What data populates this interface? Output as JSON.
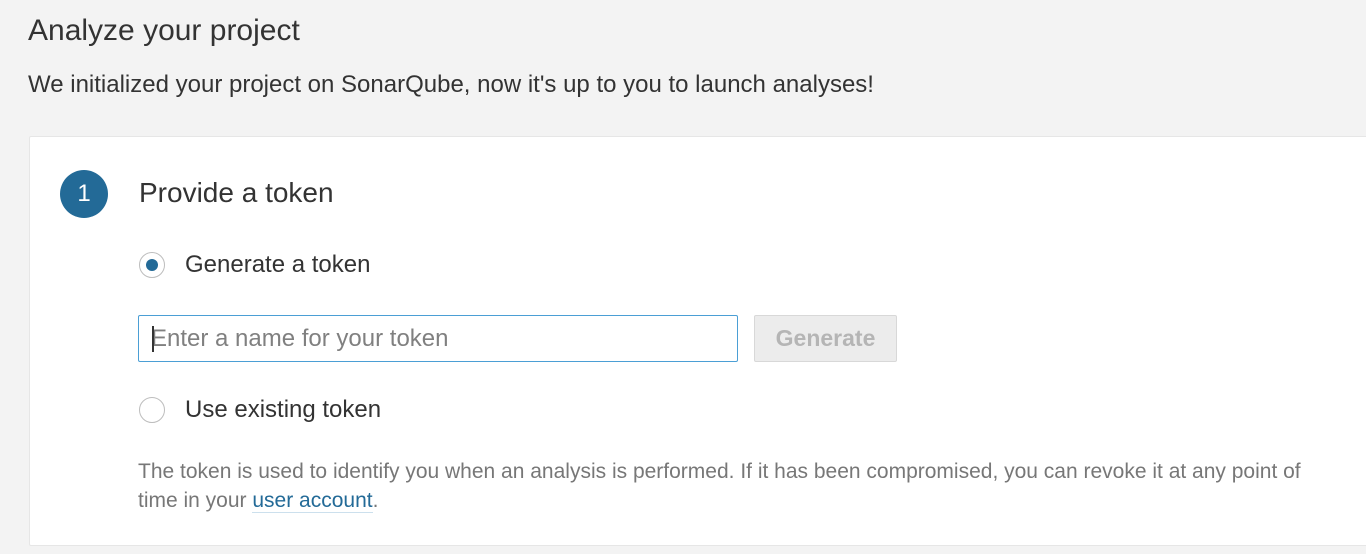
{
  "header": {
    "title": "Analyze your project",
    "description": "We initialized your project on SonarQube, now it's up to you to launch analyses!"
  },
  "step": {
    "number": "1",
    "title": "Provide a token",
    "options": {
      "generate": {
        "label": "Generate a token",
        "checked": true
      },
      "existing": {
        "label": "Use existing token",
        "checked": false
      }
    },
    "token_input": {
      "value": "",
      "placeholder": "Enter a name for your token"
    },
    "generate_button": {
      "label": "Generate",
      "disabled": true
    },
    "help": {
      "text_before": "The token is used to identify you when an analysis is performed. If it has been compromised, you can revoke it at any point of time in your ",
      "link": "user account",
      "text_after": "."
    }
  },
  "colors": {
    "accent": "#236a97",
    "page_background": "#f3f3f3",
    "card_background": "#ffffff",
    "input_focus_border": "#4b9fd5",
    "muted_text": "#777777"
  }
}
